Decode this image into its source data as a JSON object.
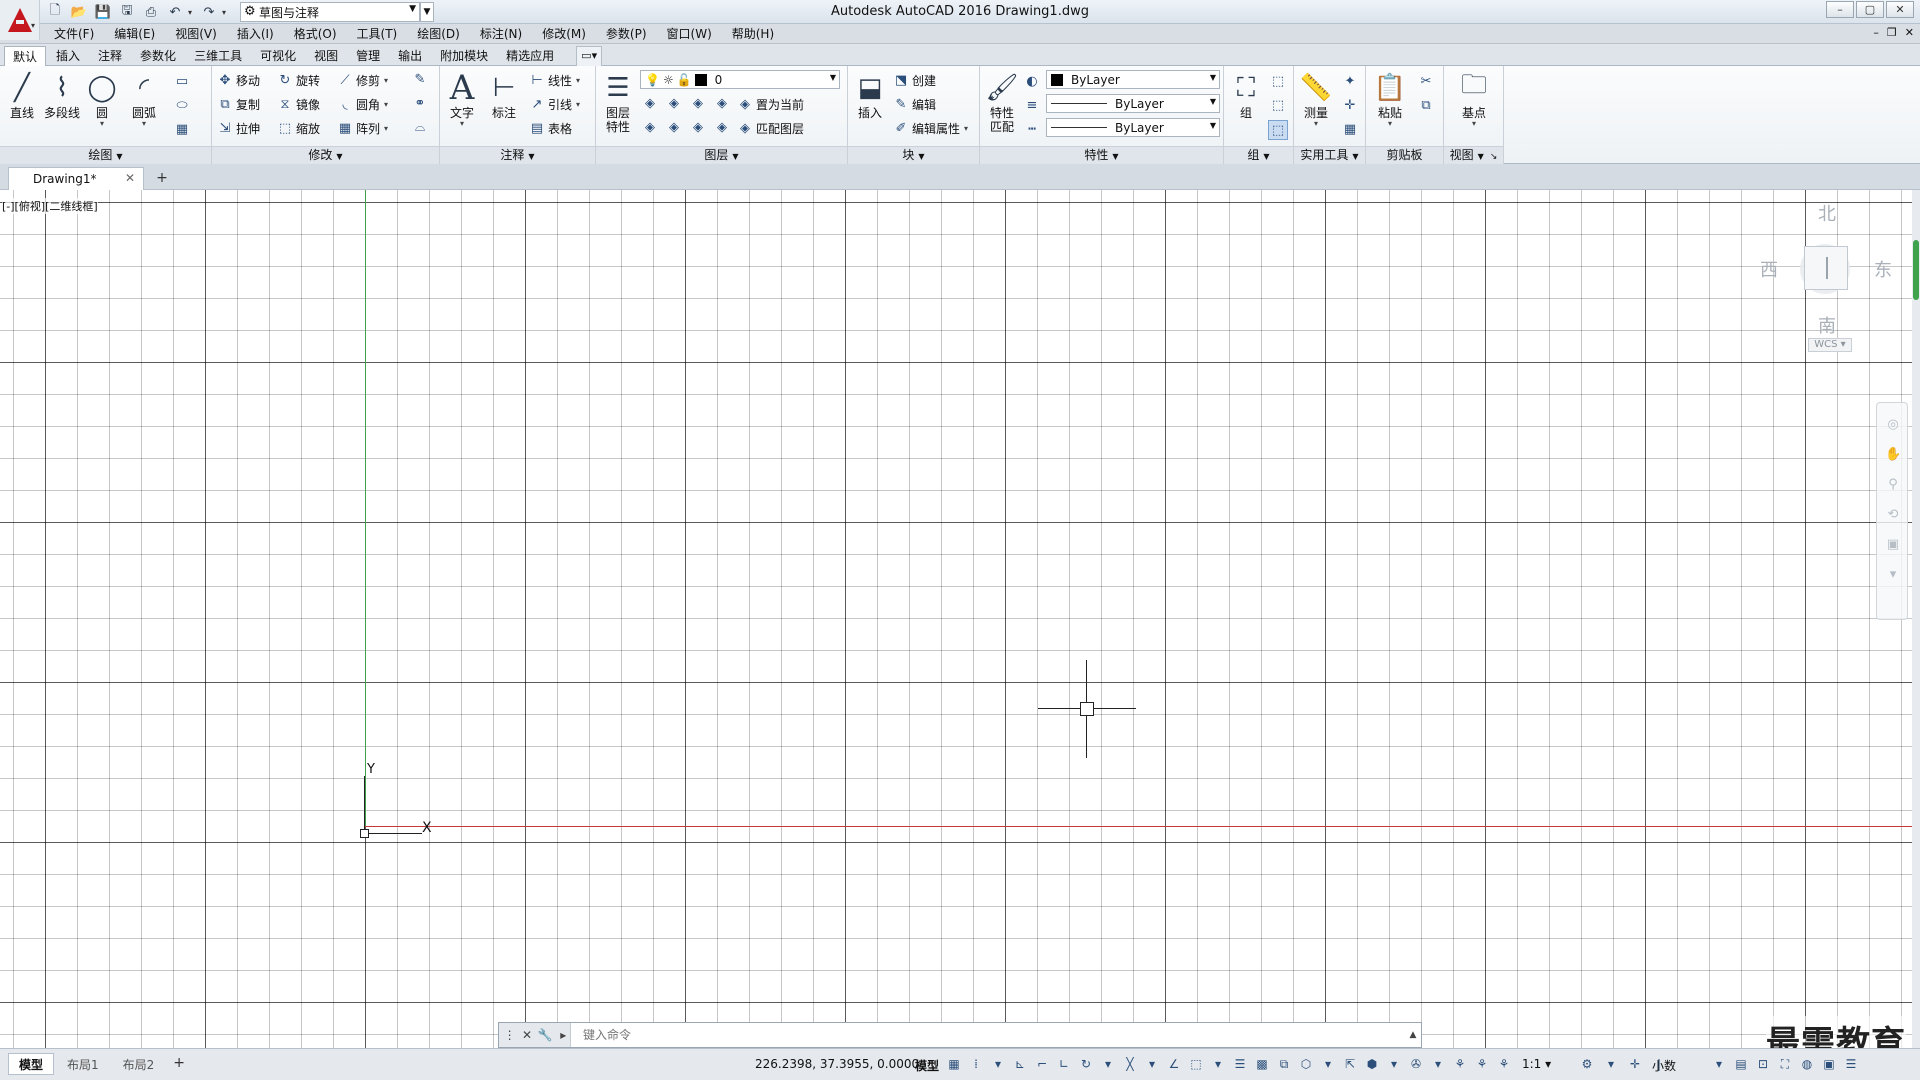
{
  "title_bar": {
    "window_title": "Autodesk AutoCAD 2016    Drawing1.dwg",
    "workspace": "草图与注释",
    "controls": [
      "–",
      "▢",
      "✕"
    ]
  },
  "menu": {
    "items": [
      "文件(F)",
      "编辑(E)",
      "视图(V)",
      "插入(I)",
      "格式(O)",
      "工具(T)",
      "绘图(D)",
      "标注(N)",
      "修改(M)",
      "参数(P)",
      "窗口(W)",
      "帮助(H)"
    ],
    "doc_controls": [
      "–",
      "❐",
      "✕"
    ]
  },
  "ribbon_tabs": [
    "默认",
    "插入",
    "注释",
    "参数化",
    "三维工具",
    "可视化",
    "视图",
    "管理",
    "输出",
    "附加模块",
    "精选应用"
  ],
  "ribbon": {
    "draw": {
      "title": "绘图",
      "line": "直线",
      "polyline": "多段线",
      "circle": "圆",
      "arc": "圆弧"
    },
    "modify": {
      "title": "修改",
      "move": "移动",
      "rotate": "旋转",
      "trim": "修剪",
      "copy": "复制",
      "mirror": "镜像",
      "fillet": "圆角",
      "stretch": "拉伸",
      "scale": "缩放",
      "array": "阵列"
    },
    "annotation": {
      "title": "注释",
      "text": "文字",
      "dimension": "标注",
      "linear": "线性",
      "leader": "引线",
      "table": "表格"
    },
    "layers": {
      "title": "图层",
      "properties_line1": "图层",
      "properties_line2": "特性",
      "current_layer": "0",
      "set_current": "置为当前",
      "match_layer": "匹配图层"
    },
    "block": {
      "title": "块",
      "insert": "插入",
      "create": "创建",
      "edit": "编辑",
      "edit_attributes": "编辑属性"
    },
    "properties": {
      "title": "特性",
      "match_line1": "特性",
      "match_line2": "匹配",
      "color": "ByLayer",
      "linetype": "ByLayer",
      "lineweight": "ByLayer"
    },
    "groups": {
      "title": "组",
      "group": "组"
    },
    "utilities": {
      "title": "实用工具",
      "measure": "测量"
    },
    "clipboard": {
      "title": "剪贴板",
      "paste": "粘贴"
    },
    "view": {
      "title": "视图",
      "base": "基点"
    }
  },
  "document": {
    "tab": "Drawing1*"
  },
  "viewport": {
    "label": "[-][俯视][二维线框]",
    "y_label": "Y",
    "x_label": "X"
  },
  "viewcube": {
    "north": "北",
    "south": "南",
    "east": "东",
    "west": "西",
    "wcs": "WCS ▾"
  },
  "command": {
    "placeholder": "键入命令"
  },
  "status": {
    "layouts": [
      "模型",
      "布局1",
      "布局2"
    ],
    "coords": "226.2398, 37.3955, 0.0000",
    "space": "模型",
    "scale": "1:1 ▾",
    "units": "小数"
  },
  "watermark": "最需教育",
  "colors": {
    "x_axis": "#c23a3a",
    "y_axis": "#3fa34d",
    "logo": "#c4161c"
  }
}
